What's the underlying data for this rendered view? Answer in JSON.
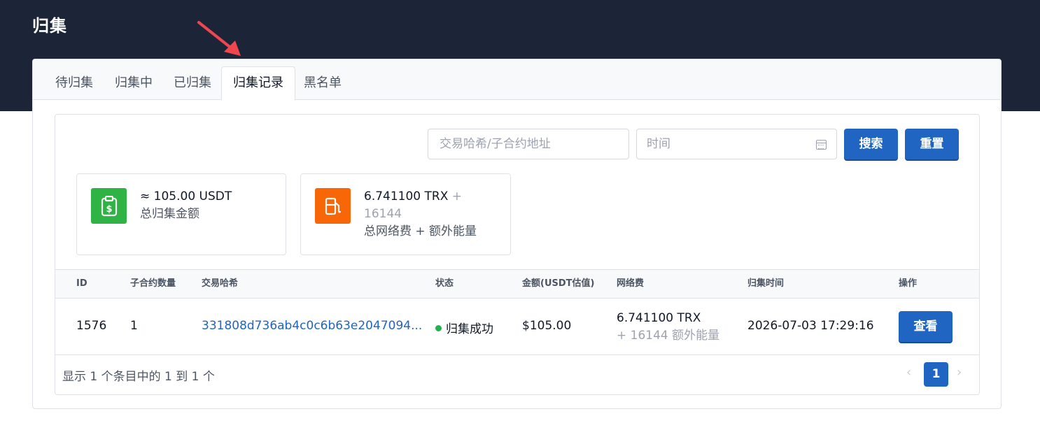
{
  "header": {
    "title": "归集"
  },
  "tabs": [
    {
      "label": "待归集"
    },
    {
      "label": "归集中"
    },
    {
      "label": "已归集"
    },
    {
      "label": "归集记录"
    },
    {
      "label": "黑名单"
    }
  ],
  "active_tab": "归集记录",
  "filters": {
    "search_placeholder": "交易哈希/子合约地址",
    "time_placeholder": "时间",
    "search_label": "搜索",
    "reset_label": "重置"
  },
  "stats": {
    "amount_value": "≈ 105.00 USDT",
    "amount_label": "总归集金额",
    "fee_value": "6.741100 TRX",
    "fee_plus": "+",
    "fee_energy": "16144",
    "fee_label": "总网络费 + 额外能量"
  },
  "table": {
    "headers": [
      "ID",
      "子合约数量",
      "交易哈希",
      "状态",
      "金额(USDT估值)",
      "网络费",
      "归集时间",
      "操作"
    ],
    "rows": [
      {
        "id": "1576",
        "count": "1",
        "hash": "331808d736ab4c0c6b63e2047094...",
        "status": "归集成功",
        "amount": "$105.00",
        "fee": "6.741100 TRX",
        "fee_extra": "+ 16144 额外能量",
        "time": "2026-07-03 17:29:16",
        "action": "查看"
      }
    ]
  },
  "footer": {
    "summary": "显示 1 个条目中的 1 到 1 个",
    "current_page": "1",
    "prev": "‹",
    "next": "›"
  },
  "colors": {
    "header_bg": "#1b2537",
    "primary": "#2165c2",
    "success": "#22b14c",
    "green_icon": "#2fb344",
    "orange_icon": "#f76707",
    "arrow": "#f0474f"
  },
  "icons": {
    "amount": "clipboard-dollar-icon",
    "fee": "gas-pump-icon",
    "time": "calendar-icon",
    "annotation": "red-arrow-icon"
  }
}
